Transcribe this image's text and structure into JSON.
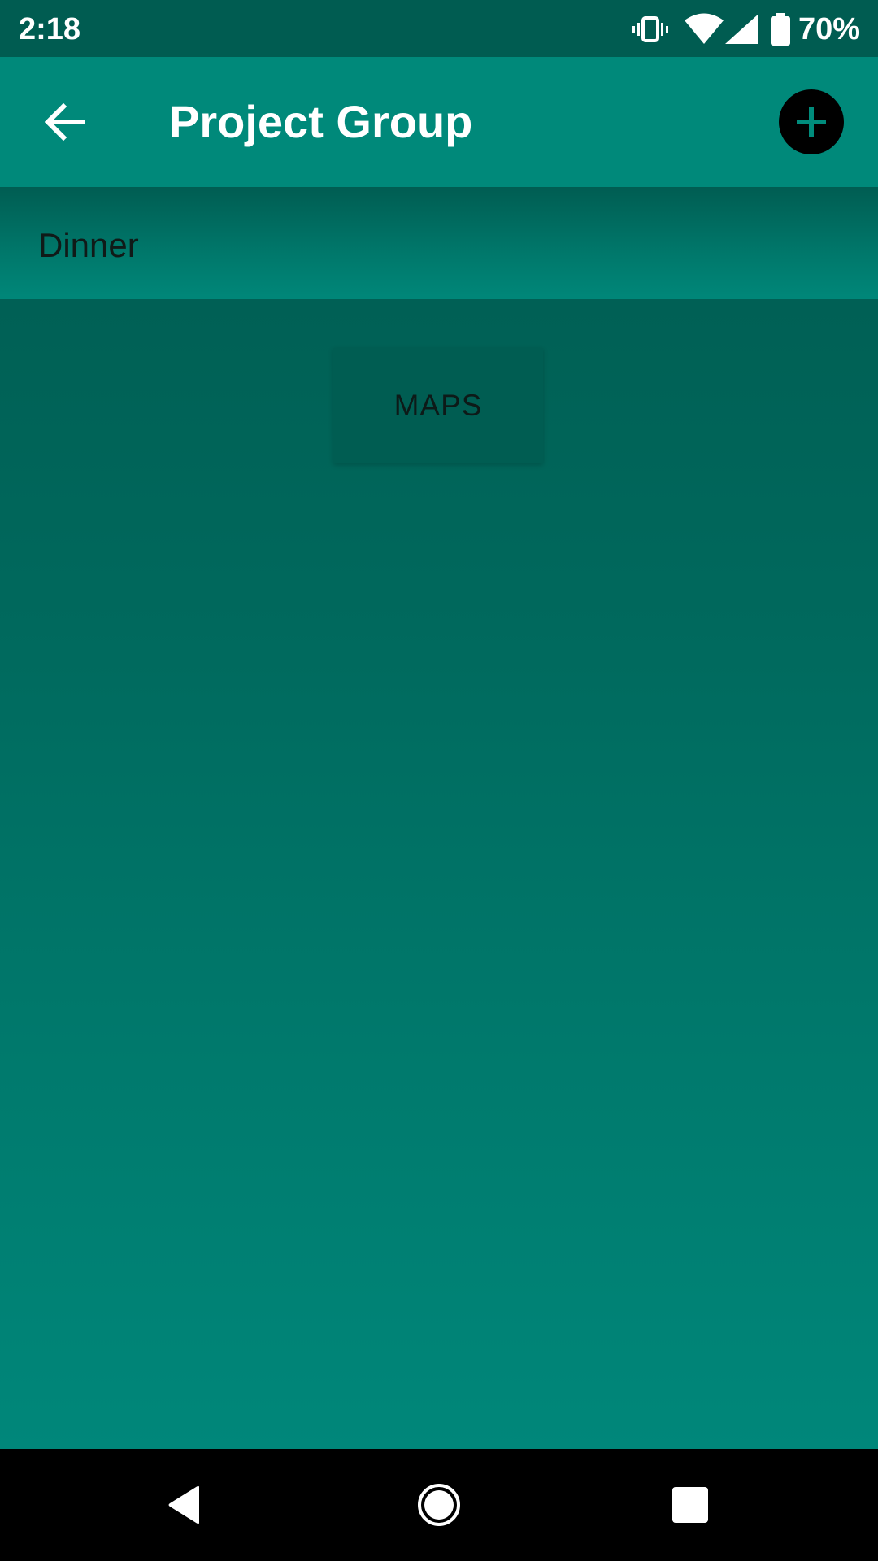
{
  "status_bar": {
    "time": "2:18",
    "battery_percent": "70%",
    "icons": [
      "vibrate-icon",
      "wifi-icon",
      "cell-signal-icon",
      "battery-icon"
    ]
  },
  "app_bar": {
    "title": "Project Group",
    "back_icon": "arrow-back-icon",
    "add_icon": "add-circle-icon"
  },
  "list": {
    "items": [
      {
        "label": "Dinner"
      }
    ]
  },
  "maps_button": {
    "label": "MAPS"
  },
  "nav_bar": {
    "icons": [
      "nav-back-icon",
      "nav-home-icon",
      "nav-recents-icon"
    ]
  },
  "colors": {
    "status_bar": "#005c51",
    "app_bar": "#00897a",
    "accent": "#008c7c",
    "text_dark": "#101a18"
  }
}
